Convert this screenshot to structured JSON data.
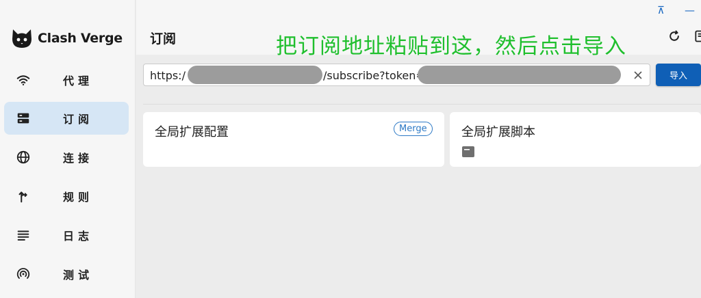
{
  "app": {
    "name": "Clash Verge",
    "colors": {
      "accent": "#0f5fb6",
      "nav_active": "#d6e6f5",
      "instruction": "#1fbf2d"
    }
  },
  "window": {
    "pin_glyph": "⊼",
    "minimize_glyph": "—"
  },
  "sidebar": {
    "items": [
      {
        "label": "代理",
        "icon": "wifi-icon"
      },
      {
        "label": "订阅",
        "icon": "server-icon",
        "active": true
      },
      {
        "label": "连接",
        "icon": "globe-icon"
      },
      {
        "label": "规则",
        "icon": "fork-arrow-icon"
      },
      {
        "label": "日志",
        "icon": "lines-icon"
      },
      {
        "label": "测试",
        "icon": "radar-icon"
      }
    ]
  },
  "header": {
    "title": "订阅",
    "instruction": "把订阅地址粘贴到这，然后点击导入",
    "refresh_icon": "refresh-icon",
    "more_icon": "note-icon"
  },
  "url_input": {
    "prefix": "https:/",
    "middle": "/subscribe?token=",
    "clear_icon": "close-icon"
  },
  "import_button": {
    "label": "导入"
  },
  "cards": [
    {
      "title": "全局扩展配置",
      "badge": "Merge"
    },
    {
      "title": "全局扩展脚本",
      "icon": "file-icon"
    }
  ]
}
